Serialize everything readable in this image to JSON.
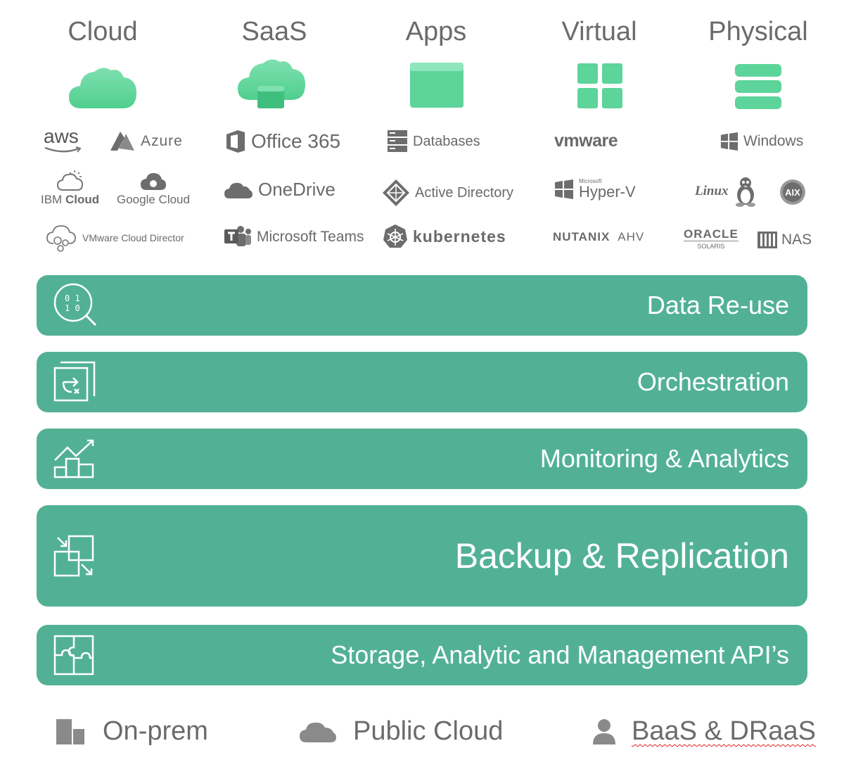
{
  "columns": [
    {
      "title": "Cloud"
    },
    {
      "title": "SaaS"
    },
    {
      "title": "Apps"
    },
    {
      "title": "Virtual"
    },
    {
      "title": "Physical"
    }
  ],
  "cloud": {
    "aws": "aws",
    "azure": "Azure",
    "ibm_prefix": "IBM",
    "ibm_bold": "Cloud",
    "google": "Google Cloud",
    "vmware_cd": "VMware Cloud Director"
  },
  "saas": {
    "office": "Office 365",
    "onedrive": "OneDrive",
    "teams": "Microsoft Teams"
  },
  "apps": {
    "databases": "Databases",
    "ad": "Active Directory",
    "k8s": "kubernetes"
  },
  "virtual": {
    "vmware": "vmware",
    "hyperv_small": "Microsoft",
    "hyperv": "Hyper-V",
    "nutanix": "NUTANIX",
    "ahv": "AHV"
  },
  "physical": {
    "windows": "Windows",
    "linux": "Linux",
    "aix": "AIX",
    "oracle": "ORACLE",
    "solaris": "SOLARIS",
    "nas": "NAS"
  },
  "bands": [
    {
      "label": "Data Re-use",
      "icon": "data-search-icon"
    },
    {
      "label": "Orchestration",
      "icon": "orchestration-icon"
    },
    {
      "label": "Monitoring & Analytics",
      "icon": "analytics-icon"
    },
    {
      "label": "Backup & Replication",
      "icon": "replication-icon"
    },
    {
      "label": "Storage, Analytic and Management API’s",
      "icon": "puzzle-icon"
    }
  ],
  "footer": [
    {
      "label": "On-prem",
      "icon": "building-icon"
    },
    {
      "label": "Public Cloud",
      "icon": "cloud-icon"
    },
    {
      "label": "BaaS & DRaaS",
      "icon": "person-icon"
    }
  ],
  "colors": {
    "accent": "#52b194",
    "icon_green": "#5dd49a",
    "text_gray": "#6b6b6b"
  }
}
